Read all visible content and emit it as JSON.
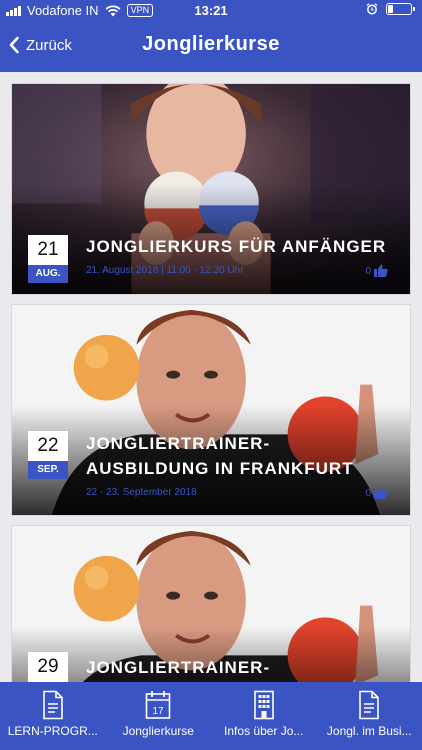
{
  "status_bar": {
    "carrier": "Vodafone IN",
    "vpn": "VPN",
    "time": "13:21"
  },
  "nav": {
    "back_label": "Zurück",
    "title": "Jonglierkurse"
  },
  "cards": [
    {
      "day": "21",
      "month": "AUG.",
      "title": "JONGLIERKURS FÜR ANFÄNGER",
      "subtitle": "21. August 2018 | 11:00 - 12:30 Uhr",
      "likes": "0"
    },
    {
      "day": "22",
      "month": "SEP.",
      "title": "JONGLIERTRAINER-AUSBILDUNG IN FRANKFURT",
      "subtitle": "22 - 23. September 2018",
      "likes": "0"
    },
    {
      "day": "29",
      "month": "",
      "title": "JONGLIERTRAINER-AUSBILDUNG",
      "subtitle": "",
      "likes": ""
    }
  ],
  "tabs": [
    {
      "label": "LERN-PROGR...",
      "icon": "document-icon"
    },
    {
      "label": "Jonglierkurse",
      "icon": "calendar-icon",
      "icon_text": "17"
    },
    {
      "label": "Infos über Jo...",
      "icon": "building-icon"
    },
    {
      "label": "Jongl. im Busi...",
      "icon": "document-icon"
    }
  ],
  "colors": {
    "primary": "#3a54c4",
    "background": "#e9e9ee"
  }
}
